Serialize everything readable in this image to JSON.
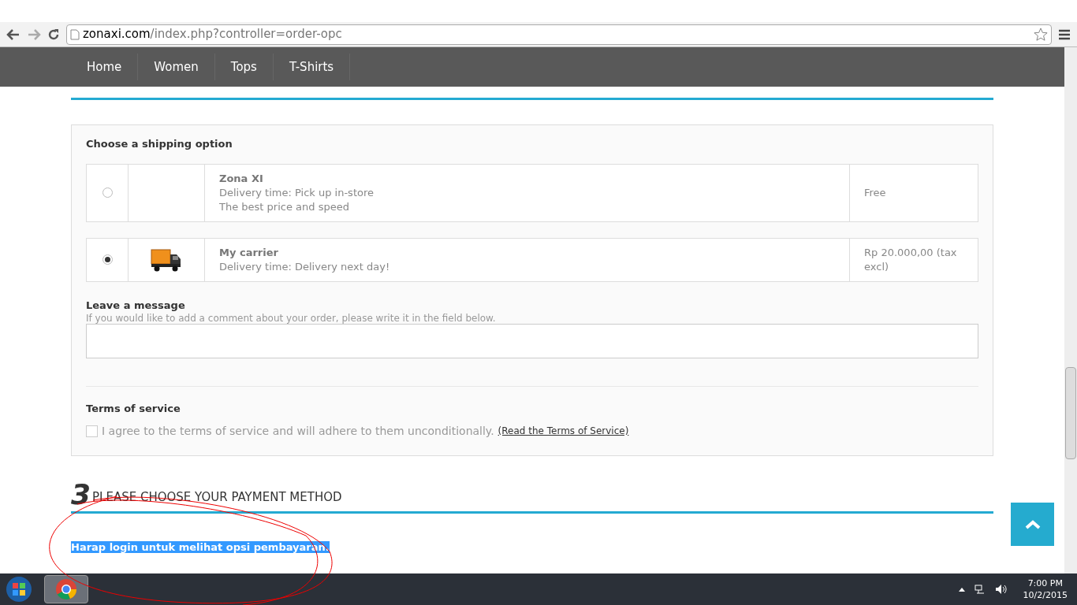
{
  "browser": {
    "url_domain": "zonaxi.com",
    "url_path": "/index.php?controller=order-opc"
  },
  "nav": [
    {
      "label": "Home"
    },
    {
      "label": "Women"
    },
    {
      "label": "Tops"
    },
    {
      "label": "T-Shirts"
    }
  ],
  "shipping": {
    "heading": "Choose a shipping option",
    "options": [
      {
        "selected": false,
        "kind": "none",
        "name": "Zona XI",
        "lines": [
          "Delivery time: Pick up in-store",
          "The best price and speed"
        ],
        "price": "Free"
      },
      {
        "selected": true,
        "kind": "truck",
        "name": "My carrier",
        "lines": [
          "Delivery time: Delivery next day!"
        ],
        "price": "Rp 20.000,00 (tax excl)"
      }
    ]
  },
  "message": {
    "heading": "Leave a message",
    "hint": "If you would like to add a comment about your order, please write it in the field below."
  },
  "terms": {
    "heading": "Terms of service",
    "checked": false,
    "text": "I agree to the terms of service and will adhere to them unconditionally.",
    "link": "(Read the Terms of Service)"
  },
  "payment": {
    "number": "3",
    "heading": "PLEASE CHOOSE YOUR PAYMENT METHOD",
    "notice": "Harap login untuk melihat opsi pembayaran.",
    "highlighted": true
  },
  "taskbar": {
    "time": "7:00 PM",
    "date": "10/2/2015"
  }
}
